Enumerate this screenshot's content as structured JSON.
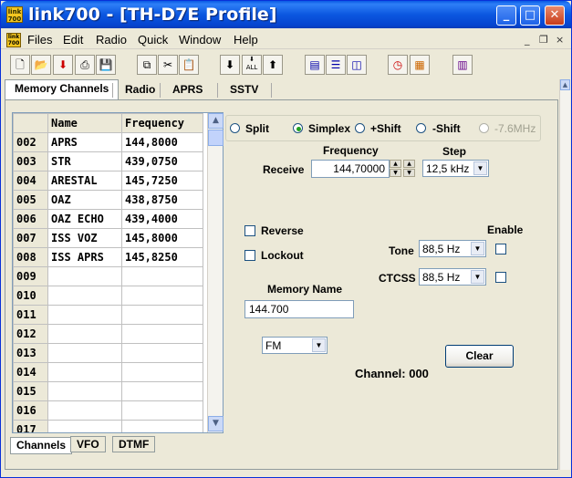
{
  "window": {
    "title": "link700 - [TH-D7E Profile]",
    "app_icon_text": "link 700",
    "controls": [
      "_",
      "□",
      "✕"
    ]
  },
  "menubar": {
    "items": [
      "Files",
      "Edit",
      "Radio",
      "Quick",
      "Window",
      "Help"
    ],
    "mdi_controls": [
      "_",
      "❐",
      "×"
    ]
  },
  "toolbar": {
    "buttons": [
      "new-icon",
      "open-icon",
      "import-icon",
      "print-icon",
      "save-icon",
      "copy-icon",
      "cut-icon",
      "paste-icon",
      "download-icon",
      "download-all-icon",
      "upload-icon",
      "tile-icon",
      "split-h-icon",
      "split-v-icon",
      "clock-icon",
      "calendar-icon",
      "book-icon"
    ],
    "all_label": "ALL"
  },
  "tabs": {
    "top": [
      "Memory Channels",
      "Radio",
      "APRS",
      "SSTV"
    ],
    "bottom": [
      "Channels",
      "VFO",
      "DTMF"
    ]
  },
  "table": {
    "headers": [
      "Name",
      "Frequency"
    ],
    "rows": [
      [
        "002",
        "APRS",
        "144,8000"
      ],
      [
        "003",
        "STR",
        "439,0750"
      ],
      [
        "004",
        "ARESTAL",
        "145,7250"
      ],
      [
        "005",
        "OAZ",
        "438,8750"
      ],
      [
        "006",
        "OAZ ECHO",
        "439,4000"
      ],
      [
        "007",
        "ISS VOZ",
        "145,8000"
      ],
      [
        "008",
        "ISS APRS",
        "145,8250"
      ],
      [
        "009",
        "",
        ""
      ],
      [
        "010",
        "",
        ""
      ],
      [
        "011",
        "",
        ""
      ],
      [
        "012",
        "",
        ""
      ],
      [
        "013",
        "",
        ""
      ],
      [
        "014",
        "",
        ""
      ],
      [
        "015",
        "",
        ""
      ],
      [
        "016",
        "",
        ""
      ],
      [
        "017",
        "",
        ""
      ]
    ]
  },
  "shift": {
    "options": [
      "Split",
      "Simplex",
      "+Shift",
      "-Shift",
      "-7.6MHz"
    ],
    "selected": "Simplex"
  },
  "frequency": {
    "freq_label": "Frequency",
    "step_label": "Step",
    "receive_label": "Receive",
    "receive_value": "144,70000",
    "step_value": "12,5 kHz"
  },
  "options": {
    "reverse_label": "Reverse",
    "lockout_label": "Lockout",
    "enable_label": "Enable",
    "tone_label": "Tone",
    "tone_value": "88,5 Hz",
    "ctcss_label": "CTCSS",
    "ctcss_value": "88,5 Hz"
  },
  "memory": {
    "name_label": "Memory Name",
    "name_value": "144.700",
    "mode_value": "FM",
    "clear_label": "Clear",
    "channel_text": "Channel: 000"
  }
}
